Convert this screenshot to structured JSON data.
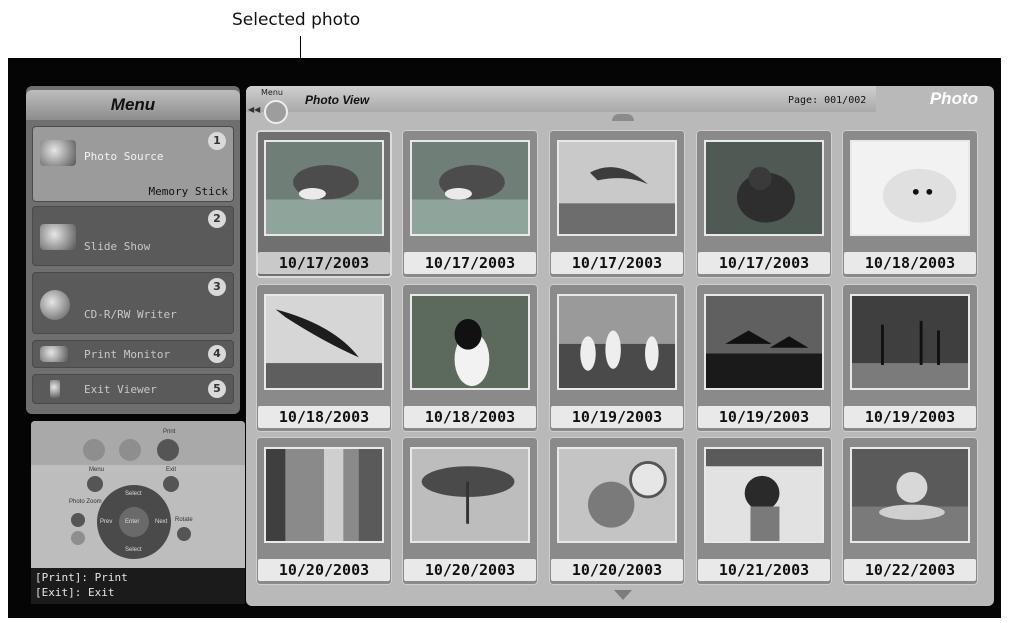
{
  "annotation": "Selected photo",
  "menu": {
    "title": "Menu",
    "items": [
      {
        "label": "Photo Source",
        "num": "1",
        "sub": "Memory Stick",
        "icon": "camera-icon"
      },
      {
        "label": "Slide Show",
        "num": "2",
        "icon": "slideshow-icon"
      },
      {
        "label": "CD-R/RW Writer",
        "num": "3",
        "icon": "disc-icon"
      },
      {
        "label": "Print Monitor",
        "num": "4",
        "icon": "printer-icon"
      },
      {
        "label": "Exit Viewer",
        "num": "5",
        "icon": "door-icon"
      }
    ]
  },
  "remote": {
    "top_labels": [
      "Print"
    ],
    "buttons": {
      "menu": "Menu",
      "exit": "Exit",
      "photo_zoom": "Photo Zoom",
      "rotate": "Rotate",
      "enter": "Enter",
      "select": "Select",
      "prev": "Prev",
      "next": "Next"
    },
    "help": [
      "[Print]: Print",
      "[Exit]: Exit"
    ]
  },
  "header": {
    "menu_button": "Menu",
    "back": "◀◀",
    "view_title": "Photo View",
    "page": "Page: 001/002",
    "tab": "Photo"
  },
  "photos": [
    {
      "date": "10/17/2003",
      "subject": "dolphin",
      "selected": true
    },
    {
      "date": "10/17/2003",
      "subject": "dolphin"
    },
    {
      "date": "10/17/2003",
      "subject": "jumping-dolphin"
    },
    {
      "date": "10/17/2003",
      "subject": "sea-lion"
    },
    {
      "date": "10/18/2003",
      "subject": "seal-pup"
    },
    {
      "date": "10/18/2003",
      "subject": "diving-penguin"
    },
    {
      "date": "10/18/2003",
      "subject": "penguin"
    },
    {
      "date": "10/19/2003",
      "subject": "penguins"
    },
    {
      "date": "10/19/2003",
      "subject": "sunset-huts"
    },
    {
      "date": "10/19/2003",
      "subject": "palm-sunset"
    },
    {
      "date": "10/20/2003",
      "subject": "alley"
    },
    {
      "date": "10/20/2003",
      "subject": "parasol"
    },
    {
      "date": "10/20/2003",
      "subject": "tilted-portrait"
    },
    {
      "date": "10/21/2003",
      "subject": "photographer"
    },
    {
      "date": "10/22/2003",
      "subject": "swimmer"
    }
  ]
}
